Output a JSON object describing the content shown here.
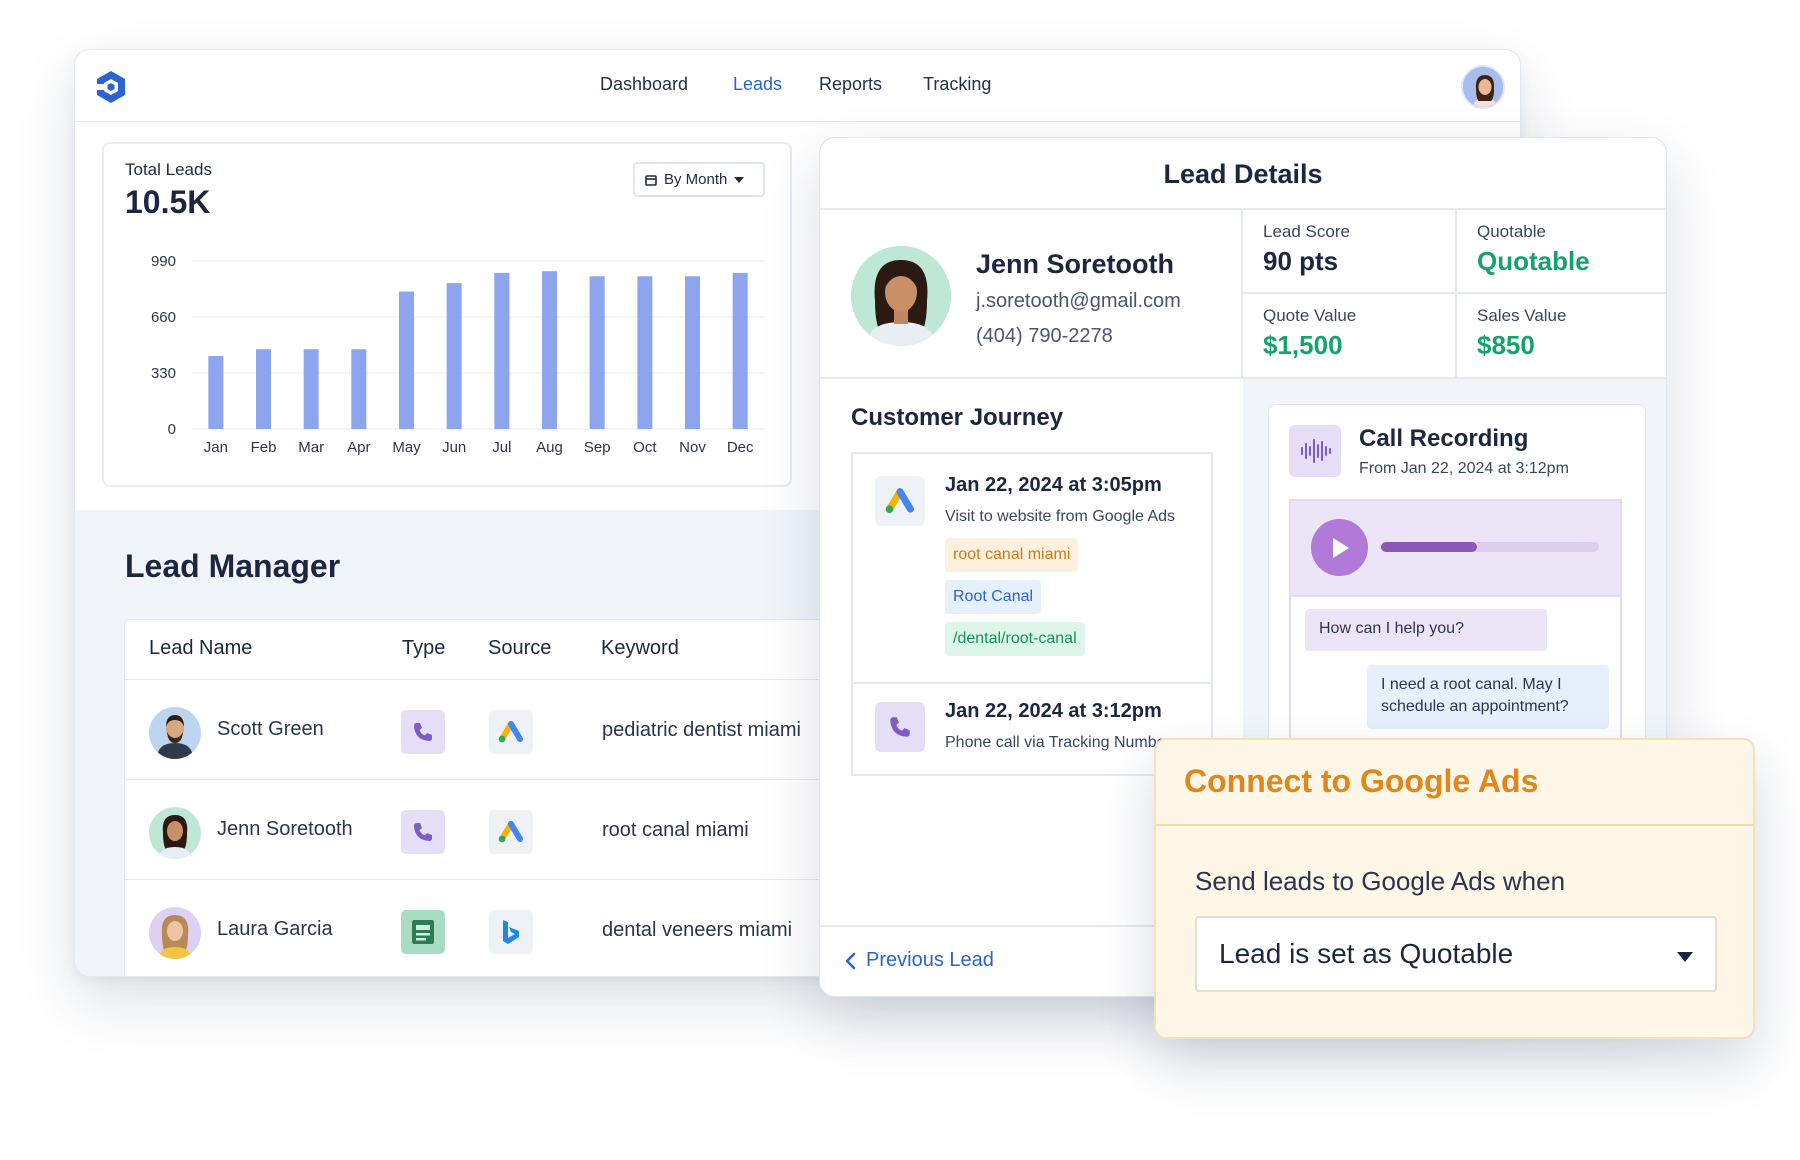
{
  "nav": {
    "items": [
      "Dashboard",
      "Leads",
      "Reports",
      "Tracking"
    ],
    "active": "Leads"
  },
  "chart": {
    "title": "Total Leads",
    "total": "10.5K",
    "filter_label": "By Month"
  },
  "chart_data": {
    "type": "bar",
    "categories": [
      "Jan",
      "Feb",
      "Mar",
      "Apr",
      "May",
      "Jun",
      "Jul",
      "Aug",
      "Sep",
      "Oct",
      "Nov",
      "Dec"
    ],
    "values": [
      430,
      470,
      470,
      470,
      810,
      860,
      920,
      930,
      900,
      900,
      900,
      920
    ],
    "yticks": [
      0,
      330,
      660,
      990
    ],
    "ylim": [
      0,
      990
    ],
    "title": "Total Leads",
    "xlabel": "",
    "ylabel": "",
    "grid": true,
    "color": "#8da4ee"
  },
  "lead_manager": {
    "title": "Lead Manager",
    "columns": [
      "Lead Name",
      "Type",
      "Source",
      "Keyword"
    ],
    "rows": [
      {
        "name": "Scott Green",
        "type": "phone-icon",
        "source": "google-ads-icon",
        "keyword": "pediatric dentist miami"
      },
      {
        "name": "Jenn Soretooth",
        "type": "phone-icon",
        "source": "google-ads-icon",
        "keyword": "root canal miami"
      },
      {
        "name": "Laura Garcia",
        "type": "form-icon",
        "source": "bing-icon",
        "keyword": "dental veneers miami"
      }
    ]
  },
  "details": {
    "title": "Lead Details",
    "profile": {
      "name": "Jenn Soretooth",
      "email": "j.soretooth@gmail.com",
      "phone": "(404) 790-2278"
    },
    "stats": [
      {
        "label": "Lead Score",
        "value": "90 pts"
      },
      {
        "label": "Quotable",
        "value": "Quotable"
      },
      {
        "label": "Quote Value",
        "value": "$1,500"
      },
      {
        "label": "Sales Value",
        "value": "$850"
      }
    ],
    "journey": {
      "title": "Customer Journey",
      "items": [
        {
          "date": "Jan 22, 2024 at 3:05pm",
          "desc": "Visit to website from Google Ads",
          "tags": [
            "root canal miami",
            "Root Canal",
            "/dental/root-canal"
          ]
        },
        {
          "date": "Jan 22, 2024 at 3:12pm",
          "desc": "Phone call via Tracking Number"
        }
      ]
    },
    "call": {
      "title": "Call Recording",
      "subtitle": "From Jan 22, 2024 at 3:12pm",
      "progress": 0.44,
      "messages": [
        "How can I help you?",
        "I need a root canal. May I schedule an appointment?"
      ]
    },
    "footer": {
      "prev_label": "Previous Lead"
    }
  },
  "google_ads": {
    "title": "Connect to Google Ads",
    "label": "Send leads to Google Ads when",
    "selected": "Lead is set as Quotable"
  },
  "colors": {
    "accent": "#2b63d0",
    "green": "#14a36b",
    "orange": "#e0861a",
    "bar": "#8da4ee",
    "purple": "#b17ad9"
  }
}
